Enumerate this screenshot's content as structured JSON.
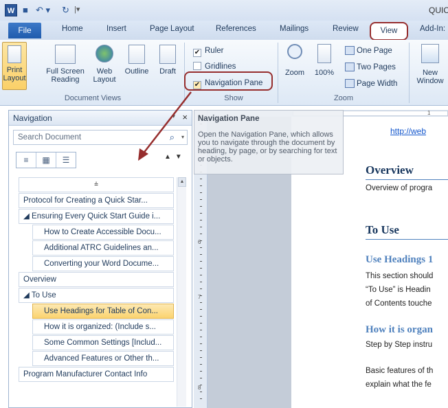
{
  "qat": {
    "app_logo": "W",
    "save_glyph": "■",
    "undo_glyph": "↶ ▾",
    "redo_glyph": "↻",
    "custom_glyph": "|▾",
    "title": "QUIC"
  },
  "tabs": {
    "file": "File",
    "home": "Home",
    "insert": "Insert",
    "page_layout": "Page Layout",
    "references": "References",
    "mailings": "Mailings",
    "review": "Review",
    "view": "View",
    "addins": "Add-In:"
  },
  "ribbon": {
    "document_views": {
      "label": "Document Views",
      "print_layout": [
        "Print",
        "Layout"
      ],
      "full_screen": [
        "Full Screen",
        "Reading"
      ],
      "web": [
        "Web",
        "Layout"
      ],
      "outline": "Outline",
      "draft": "Draft"
    },
    "show": {
      "label": "Show",
      "ruler": "Ruler",
      "ruler_checked": "✔",
      "gridlines": "Gridlines",
      "navigation_pane": "Navigation Pane",
      "nav_checked": "✔"
    },
    "zoom": {
      "label": "Zoom",
      "zoom": "Zoom",
      "hundred": "100%",
      "one_page": "One Page",
      "two_pages": "Two Pages",
      "page_width": "Page Width"
    },
    "window": {
      "new_window": [
        "New",
        "Window"
      ]
    }
  },
  "nav": {
    "title": "Navigation",
    "close": "×",
    "menu_arrow": "▾",
    "search_placeholder": "Search Document",
    "search_icon": "⌕",
    "search_dd": "▾",
    "tabs": [
      "≡",
      "▦",
      "☰"
    ],
    "up_down": "▲▼",
    "collapse_glyph": "⩮",
    "items": [
      {
        "label": "Protocol for Creating a Quick Star...",
        "level": 1
      },
      {
        "label": "◢ Ensuring Every Quick Start Guide i...",
        "level": 1
      },
      {
        "label": "How to Create Accessible Docu...",
        "level": 2
      },
      {
        "label": "Additional ATRC Guidelines an...",
        "level": 2
      },
      {
        "label": "Converting your Word Docume...",
        "level": 2
      },
      {
        "label": "Overview",
        "level": 1
      },
      {
        "label": "◢ To Use",
        "level": 1
      },
      {
        "label": "Use Headings for Table of Con...",
        "level": 2,
        "selected": true
      },
      {
        "label": "How it is organized: (Include s...",
        "level": 2
      },
      {
        "label": "Some Common Settings [Includ...",
        "level": 2
      },
      {
        "label": "Advanced Features or Other th...",
        "level": 2
      },
      {
        "label": "Program Manufacturer Contact Info",
        "level": 1
      }
    ]
  },
  "tooltip": {
    "title": "Navigation Pane",
    "body": "Open the Navigation Pane, which allows you to navigate through the document by heading, by page, or by searching for text or objects."
  },
  "ruler": {
    "h_mark": "1",
    "v_marks": [
      "6",
      "7",
      "8"
    ]
  },
  "document": {
    "link": "http://web",
    "h_overview": "Overview",
    "p_overview": "Overview of progra",
    "h_to_use": "To Use",
    "h_use_headings": "Use Headings 1",
    "p1": "This section should",
    "p2": "“To Use” is Headin",
    "p3": "of Contents touche",
    "h_how": "How it is organ",
    "p4": "Step by Step instru",
    "p5": "Basic features of th",
    "p6": "explain what the fe"
  },
  "colors": {
    "highlight": "#962d2d",
    "selected": "#fbd36f",
    "accent": "#2b579a"
  }
}
